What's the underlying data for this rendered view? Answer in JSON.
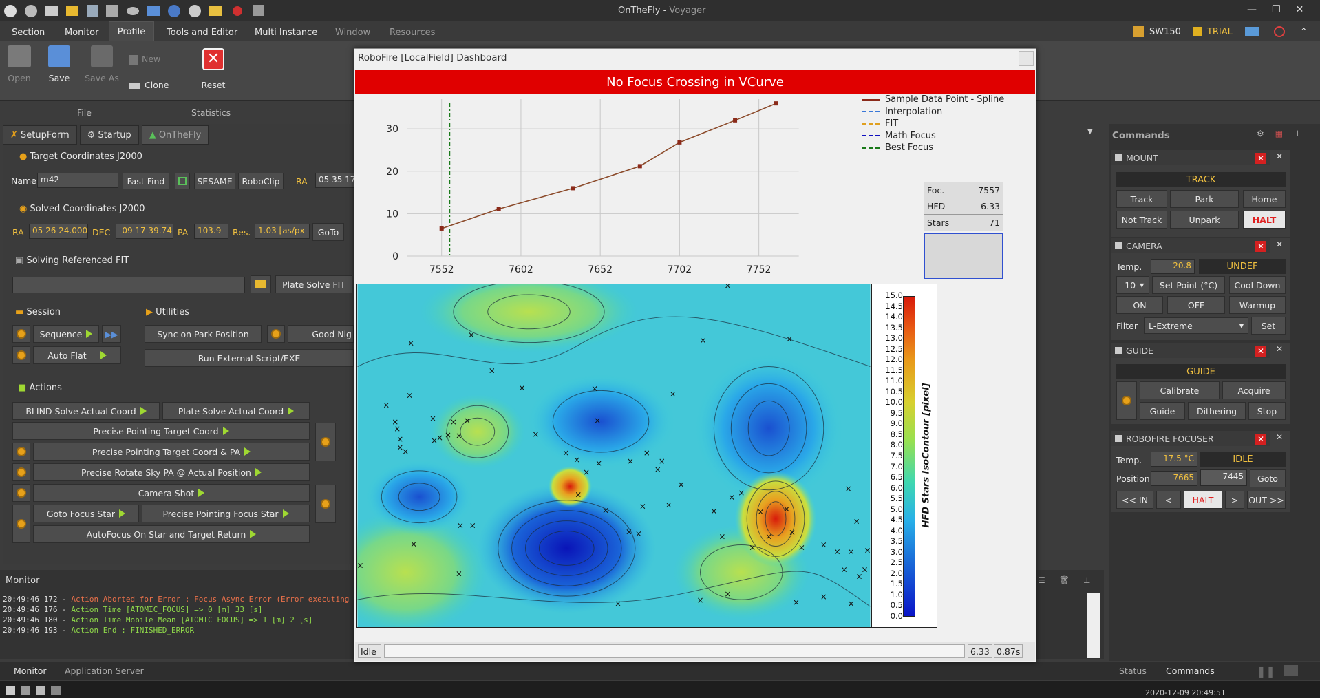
{
  "window": {
    "title": "OnTheFly",
    "app": "Voyager"
  },
  "menu": [
    "Section",
    "Monitor",
    "Profile",
    "Tools and Editor",
    "Multi Instance",
    "Window",
    "Resources"
  ],
  "status_right": {
    "sw": "SW150",
    "trial": "TRIAL"
  },
  "ribbon": {
    "open": "Open",
    "save": "Save",
    "save_as": "Save As",
    "new": "New",
    "clone": "Clone",
    "reset": "Reset",
    "group_file": "File",
    "group_stats": "Statistics"
  },
  "tabs": [
    "SetupForm",
    "Startup",
    "OnTheFly"
  ],
  "target": {
    "header": "Target Coordinates J2000",
    "name_label": "Name",
    "name": "m42",
    "fast_find": "Fast Find",
    "sesame": "SESAME",
    "roboclip": "RoboClip",
    "ra_label": "RA",
    "ra": "05 35 17"
  },
  "solved": {
    "header": "Solved Coordinates J2000",
    "ra_label": "RA",
    "ra": "05 26 24.000",
    "dec_label": "DEC",
    "dec": "-09 17 39.74",
    "pa_label": "PA",
    "pa": "103.9",
    "res_label": "Res.",
    "res": "1.03 [as/px",
    "goto": "GoTo"
  },
  "solving": {
    "header": "Solving Referenced FIT",
    "plate_solve": "Plate Solve FIT"
  },
  "session": {
    "header": "Session",
    "sequence": "Sequence",
    "auto_flat": "Auto Flat"
  },
  "utilities": {
    "header": "Utilities",
    "sync": "Sync on Park Position",
    "good_night": "Good Nig",
    "run_ext": "Run External Script/EXE"
  },
  "actions": {
    "header": "Actions",
    "blind": "BLIND Solve Actual Coord",
    "plate_actual": "Plate Solve Actual Coord",
    "precise_target": "Precise Pointing Target Coord",
    "precise_target_pa": "Precise Pointing Target Coord & PA",
    "precise_rotate": "Precise Rotate Sky PA @ Actual Position",
    "camera_shot": "Camera Shot",
    "goto_focus": "Goto Focus Star",
    "precise_focus": "Precise Pointing Focus Star",
    "autofocus": "AutoFocus On Star and Target Return"
  },
  "monitor": {
    "title": "Monitor",
    "lines": [
      {
        "ts": "20:49:46 172",
        "text": "Action Aborted for Error : Focus Async Error (Error executing LocalField VCurve A",
        "color": "#e8704a"
      },
      {
        "ts": "20:49:46 176",
        "text": "Action Time [ATOMIC_FOCUS] => 0 [m] 33 [s]",
        "color": "#8fd84a"
      },
      {
        "ts": "20:49:46 180",
        "text": "Action Time Mobile Mean [ATOMIC_FOCUS] => 1 [m] 2 [s]",
        "color": "#8fd84a"
      },
      {
        "ts": "20:49:46 193",
        "text": "Action End : FINISHED_ERROR",
        "color": "#8fd84a"
      }
    ],
    "tab1": "Monitor",
    "tab2": "Application Server"
  },
  "dashboard": {
    "title": "RoboFire [LocalField] Dashboard",
    "banner": "No Focus Crossing in VCurve",
    "legend": [
      "Sample Data Point - Spline",
      "Interpolation",
      "FIT",
      "Math Focus",
      "Best Focus"
    ],
    "legend_colors": [
      "#8b2a1a",
      "#3a78d8",
      "#e0a020",
      "#1010c0",
      "#1a7a1a"
    ],
    "info": [
      {
        "k": "Foc.",
        "v": "7557"
      },
      {
        "k": "HFD",
        "v": "6.33"
      },
      {
        "k": "Stars",
        "v": "71"
      }
    ],
    "status": "Idle",
    "hfd": "6.33",
    "time": "0.87s",
    "colorbar_title": "HFD Stars IsoContour [pixel]",
    "colorbar_ticks": [
      "15.0",
      "14.5",
      "14.0",
      "13.5",
      "13.0",
      "12.5",
      "12.0",
      "11.5",
      "11.0",
      "10.5",
      "10.0",
      "9.5",
      "9.0",
      "8.5",
      "8.0",
      "7.5",
      "7.0",
      "6.5",
      "6.0",
      "5.5",
      "5.0",
      "4.5",
      "4.0",
      "3.5",
      "3.0",
      "2.5",
      "2.0",
      "1.5",
      "1.0",
      "0.5",
      "0.0"
    ]
  },
  "chart_data": {
    "type": "line",
    "x": [
      7552,
      7582,
      7612,
      7642,
      7672,
      7702,
      7732,
      7762
    ],
    "y": [
      6.5,
      11.1,
      16,
      21.2,
      26.8,
      32,
      36
    ],
    "x_points": [
      7552,
      7588,
      7635,
      7677,
      7702,
      7737,
      7763
    ],
    "xticks": [
      7552,
      7602,
      7652,
      7702,
      7752
    ],
    "yticks": [
      0,
      10,
      20,
      30
    ],
    "xlim": [
      7530,
      7770
    ],
    "ylim": [
      0,
      37
    ],
    "best_focus": 7557
  },
  "commands": {
    "title": "Commands",
    "mount": {
      "title": "MOUNT",
      "state": "TRACK",
      "track": "Track",
      "park": "Park",
      "home": "Home",
      "not_track": "Not Track",
      "unpark": "Unpark",
      "halt": "HALT"
    },
    "camera": {
      "title": "CAMERA",
      "temp_label": "Temp.",
      "temp": "20.8",
      "state": "UNDEF",
      "setpoint": "-10",
      "set_point_btn": "Set Point (°C)",
      "cool_down": "Cool Down",
      "on": "ON",
      "off": "OFF",
      "warmup": "Warmup",
      "filter_label": "Filter",
      "filter": "L-Extreme",
      "set": "Set"
    },
    "guide": {
      "title": "GUIDE",
      "state": "GUIDE",
      "calibrate": "Calibrate",
      "acquire": "Acquire",
      "guide": "Guide",
      "dithering": "Dithering",
      "stop": "Stop"
    },
    "focuser": {
      "title": "ROBOFIRE FOCUSER",
      "temp_label": "Temp.",
      "temp": "17.5 °C",
      "state": "IDLE",
      "pos_label": "Position",
      "pos": "7665",
      "target": "7445",
      "goto": "Goto",
      "in": "<< IN",
      "lt": "<",
      "halt": "HALT",
      "gt": ">",
      "out": "OUT >>"
    },
    "tab_status": "Status",
    "tab_commands": "Commands"
  },
  "taskbar": {
    "clock": "2020-12-09   20:49:51"
  }
}
